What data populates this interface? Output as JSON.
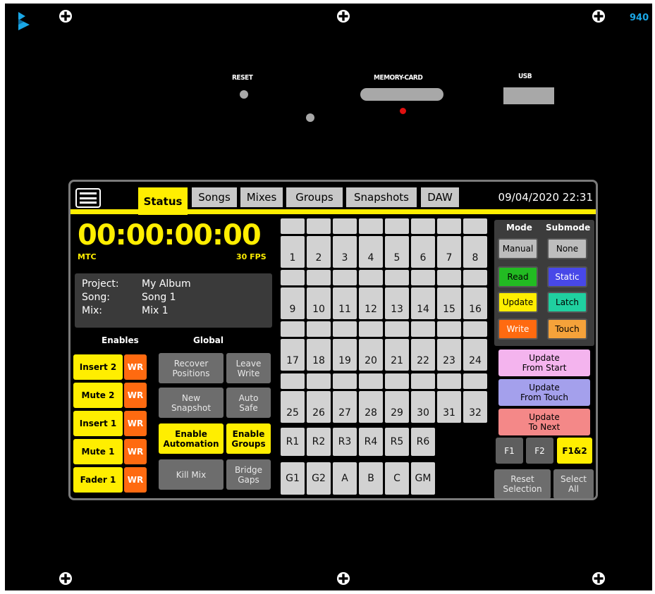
{
  "device": {
    "model_label": "940",
    "hardware_labels": {
      "reset": "RESET",
      "memory_card": "MEMORY-CARD",
      "usb": "USB"
    }
  },
  "topbar": {
    "tabs": [
      {
        "label": "Status",
        "active": true
      },
      {
        "label": "Songs",
        "active": false
      },
      {
        "label": "Mixes",
        "active": false
      },
      {
        "label": "Groups",
        "active": false
      },
      {
        "label": "Snapshots",
        "active": false
      },
      {
        "label": "DAW",
        "active": false
      }
    ],
    "datetime": "09/04/2020 22:31"
  },
  "timecode": {
    "value": "00:00:00:00",
    "source": "MTC",
    "fps": "30 FPS"
  },
  "info": {
    "project_key": "Project:",
    "project_value": "My Album",
    "song_key": "Song:",
    "song_value": "Song 1",
    "mix_key": "Mix:",
    "mix_value": "Mix 1"
  },
  "enables": {
    "header": "Enables",
    "items": [
      {
        "label": "Insert 2",
        "wr": "WR"
      },
      {
        "label": "Mute 2",
        "wr": "WR"
      },
      {
        "label": "Insert 1",
        "wr": "WR"
      },
      {
        "label": "Mute 1",
        "wr": "WR"
      },
      {
        "label": "Fader 1",
        "wr": "WR"
      }
    ]
  },
  "global": {
    "header": "Global",
    "recover_positions": [
      "Recover",
      "Positions"
    ],
    "leave_write": [
      "Leave",
      "Write"
    ],
    "new_snapshot": [
      "New",
      "Snapshot"
    ],
    "auto_safe": [
      "Auto",
      "Safe"
    ],
    "enable_automation": [
      "Enable",
      "Automation"
    ],
    "enable_groups": [
      "Enable",
      "Groups"
    ],
    "kill_mix": "Kill Mix",
    "bridge_gaps": [
      "Bridge",
      "Gaps"
    ]
  },
  "channels": {
    "rows": [
      [
        "1",
        "2",
        "3",
        "4",
        "5",
        "6",
        "7",
        "8"
      ],
      [
        "9",
        "10",
        "11",
        "12",
        "13",
        "14",
        "15",
        "16"
      ],
      [
        "17",
        "18",
        "19",
        "20",
        "21",
        "22",
        "23",
        "24"
      ],
      [
        "25",
        "26",
        "27",
        "28",
        "29",
        "30",
        "31",
        "32"
      ]
    ],
    "returns": [
      "R1",
      "R2",
      "R3",
      "R4",
      "R5",
      "R6"
    ],
    "groups": [
      "G1",
      "G2",
      "A",
      "B",
      "C",
      "GM"
    ]
  },
  "mode": {
    "header": "Mode",
    "manual": "Manual",
    "read": "Read",
    "update": "Update",
    "write": "Write"
  },
  "submode": {
    "header": "Submode",
    "none": "None",
    "static": "Static",
    "latch": "Latch",
    "touch": "Touch"
  },
  "updates": {
    "from_start": [
      "Update",
      "From Start"
    ],
    "from_touch": [
      "Update",
      "From Touch"
    ],
    "to_next": [
      "Update",
      "To Next"
    ]
  },
  "fkeys": {
    "f1": "F1",
    "f2": "F2",
    "f12": "F1&2"
  },
  "selection": {
    "reset": [
      "Reset",
      "Selection"
    ],
    "select_all": [
      "Select",
      "All"
    ]
  },
  "colors": {
    "accent_yellow": "#ffee00",
    "write_orange": "#ff6a10",
    "read_green": "#22bb22",
    "static_blue": "#4848e8",
    "latch_teal": "#20d0a0",
    "touch_orange": "#f5a23a",
    "from_start_pink": "#f4b4ee",
    "from_touch_purple": "#a4a0ec",
    "to_next_red": "#f48888",
    "model_blue": "#1aa7e6"
  }
}
